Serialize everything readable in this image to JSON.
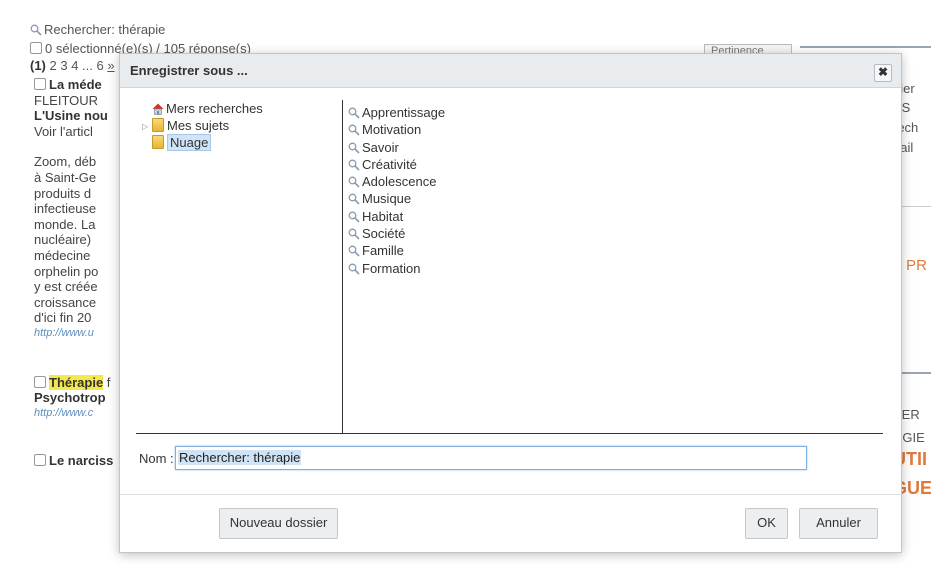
{
  "background": {
    "search_text": "Rechercher: thérapie",
    "selected_text": "0 sélectionné(e)(s) / 105 réponse(s)",
    "pagination": {
      "current": "(1)",
      "rest": "2 3 4 ... 6",
      "next": "»"
    },
    "select_label": "Pertinence",
    "results": [
      {
        "lines": [
          "La méde",
          "FLEITOUR",
          "L'Usine nou",
          "Voir l'articl"
        ]
      },
      {
        "lines": [
          "Zoom, déb",
          "à Saint-Ge",
          "produits d",
          "infectieuse",
          "monde. La",
          "nucléaire)",
          "médecine",
          "orphelin po",
          "y est créée",
          "croissance",
          "d'ici fin 20"
        ],
        "url": "http://www.u"
      },
      {
        "hl": "Thérapie",
        "rest": " f",
        "line2": "Psychotrop",
        "url": "http://www.c"
      },
      {
        "title": "Le narciss"
      }
    ],
    "right": [
      "nier",
      "SS",
      "rech",
      "nail",
      "T PR",
      "BER",
      "RGIE",
      "UTII",
      "GUE"
    ]
  },
  "dialog": {
    "title": "Enregistrer sous ...",
    "close_label": "✖",
    "tree": [
      {
        "label": "Mers recherches",
        "icon": "home-icon"
      },
      {
        "label": "Mes sujets",
        "icon": "folder-icon",
        "expandable": true
      },
      {
        "label": "Nuage",
        "icon": "folder-icon",
        "selected": true
      }
    ],
    "searches": [
      "Apprentissage",
      "Motivation",
      "Savoir",
      "Créativité",
      "Adolescence",
      "Musique",
      "Habitat",
      "Société",
      "Famille",
      "Formation"
    ],
    "name_label": "Nom :",
    "name_value": "Rechercher: thérapie",
    "new_folder_label": "Nouveau dossier",
    "ok_label": "OK",
    "cancel_label": "Annuler"
  }
}
